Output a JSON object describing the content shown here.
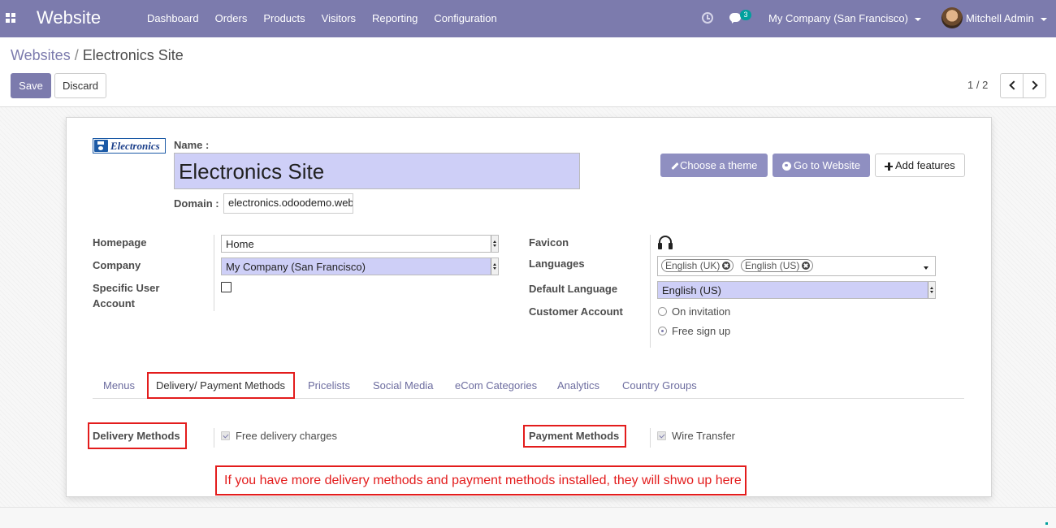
{
  "navbar": {
    "app_title": "Website",
    "menu": [
      "Dashboard",
      "Orders",
      "Products",
      "Visitors",
      "Reporting",
      "Configuration"
    ],
    "chat_badge": "3",
    "company": "My Company (San Francisco)",
    "user": "Mitchell Admin",
    "color": "#7c7bad"
  },
  "breadcrumb": {
    "parent": "Websites",
    "separator": "/",
    "current": "Electronics Site"
  },
  "actions": {
    "save": "Save",
    "discard": "Discard"
  },
  "pager": {
    "value": "1 / 2"
  },
  "form": {
    "logo_text": "Electronics",
    "name_label": "Name :",
    "name_value": "Electronics Site",
    "domain_label": "Domain :",
    "domain_value": "electronics.odoodemo.web",
    "buttons": {
      "theme": "Choose a theme",
      "goto": "Go to Website",
      "add": "Add features"
    },
    "left": {
      "homepage_label": "Homepage",
      "homepage_value": "Home",
      "company_label": "Company",
      "company_value": "My Company (San Francisco)",
      "specific_user_label_1": "Specific User",
      "specific_user_label_2": "Account",
      "specific_user_checked": false
    },
    "right": {
      "favicon_label": "Favicon",
      "favicon_icon": "headset-icon",
      "languages_label": "Languages",
      "languages": [
        "English (UK)",
        "English (US)"
      ],
      "default_language_label": "Default Language",
      "default_language_value": "English (US)",
      "customer_account_label": "Customer Account",
      "customer_account_options": [
        "On invitation",
        "Free sign up"
      ],
      "customer_account_selected": "Free sign up"
    }
  },
  "tabs": [
    "Menus",
    "Delivery/ Payment Methods",
    "Pricelists",
    "Social Media",
    "eCom Categories",
    "Analytics",
    "Country Groups"
  ],
  "active_tab": "Delivery/ Payment Methods",
  "delivery": {
    "label": "Delivery Methods",
    "item": "Free delivery charges",
    "checked": true
  },
  "payment": {
    "label": "Payment Methods",
    "item": "Wire Transfer",
    "checked": true
  },
  "annotation": "If you have more delivery methods and payment methods installed, they will shwo up here",
  "annotation_color": "#e31c1c"
}
